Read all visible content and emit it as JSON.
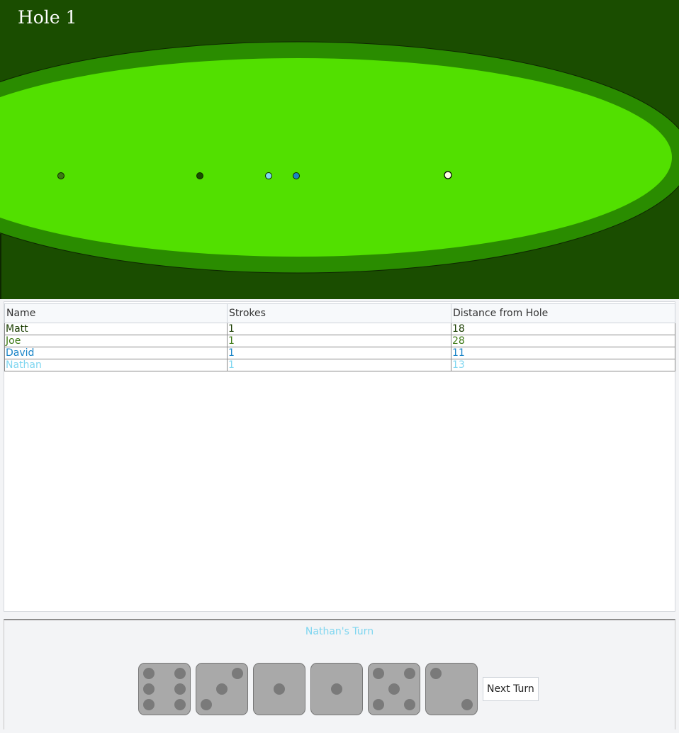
{
  "hole": {
    "title": "Hole 1"
  },
  "course": {
    "colors": {
      "rough": "#1a4d00",
      "fringe": "#2a8c00",
      "green": "#52e000",
      "hole": "#ffffe6"
    },
    "balls": [
      {
        "player": "Matt",
        "color": "#1a4d00"
      },
      {
        "player": "Joe",
        "color": "#3d7a14"
      },
      {
        "player": "David",
        "color": "#1a84c7"
      },
      {
        "player": "Nathan",
        "color": "#7fd6f0"
      }
    ]
  },
  "scoreboard": {
    "headers": {
      "name": "Name",
      "strokes": "Strokes",
      "distance": "Distance from Hole"
    },
    "rows": [
      {
        "name": "Matt",
        "strokes": "1",
        "distance": "18",
        "color": "#1a3d00"
      },
      {
        "name": "Joe",
        "strokes": "1",
        "distance": "28",
        "color": "#3d7a14"
      },
      {
        "name": "David",
        "strokes": "1",
        "distance": "11",
        "color": "#1a84c7"
      },
      {
        "name": "Nathan",
        "strokes": "1",
        "distance": "13",
        "color": "#7fd6f0"
      }
    ]
  },
  "turn": {
    "label": "Nathan's Turn",
    "color": "#7fd6f0",
    "dice": [
      6,
      3,
      1,
      1,
      5,
      2
    ],
    "next_button_label": "Next Turn"
  }
}
